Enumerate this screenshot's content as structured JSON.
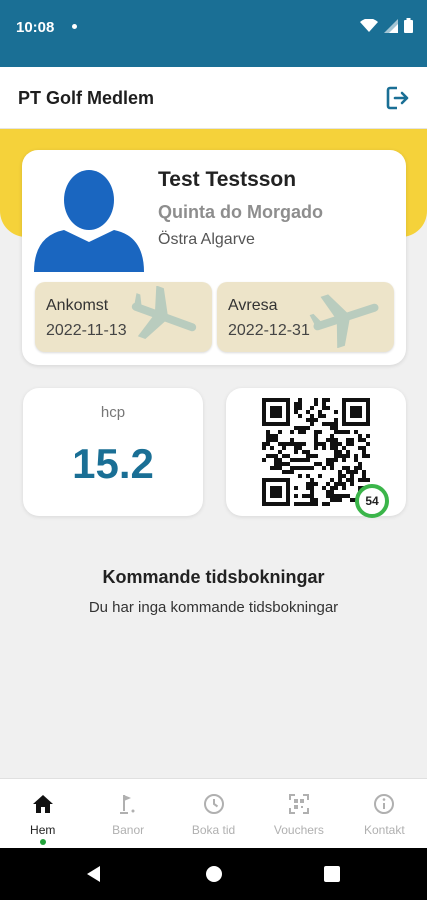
{
  "status_bar": {
    "time": "10:08"
  },
  "app_bar": {
    "title": "PT Golf Medlem"
  },
  "member": {
    "name": "Test Testsson",
    "club": "Quinta do Morgado",
    "region": "Östra Algarve",
    "arrival_label": "Ankomst",
    "arrival_date": "2022-11-13",
    "departure_label": "Avresa",
    "departure_date": "2022-12-31"
  },
  "hcp": {
    "label": "hcp",
    "value": "15.2"
  },
  "qr": {
    "countdown": "54"
  },
  "bookings": {
    "title": "Kommande tidsbokningar",
    "empty_text": "Du har inga kommande tidsbokningar"
  },
  "bottom_nav": {
    "items": [
      {
        "label": "Hem",
        "icon": "home-icon"
      },
      {
        "label": "Banor",
        "icon": "golf-flag-icon"
      },
      {
        "label": "Boka tid",
        "icon": "clock-icon"
      },
      {
        "label": "Vouchers",
        "icon": "qr-scan-icon"
      },
      {
        "label": "Kontakt",
        "icon": "info-icon"
      }
    ]
  },
  "colors": {
    "primary": "#1a6f95",
    "accent": "#f5d23a",
    "success": "#3bb54a"
  }
}
